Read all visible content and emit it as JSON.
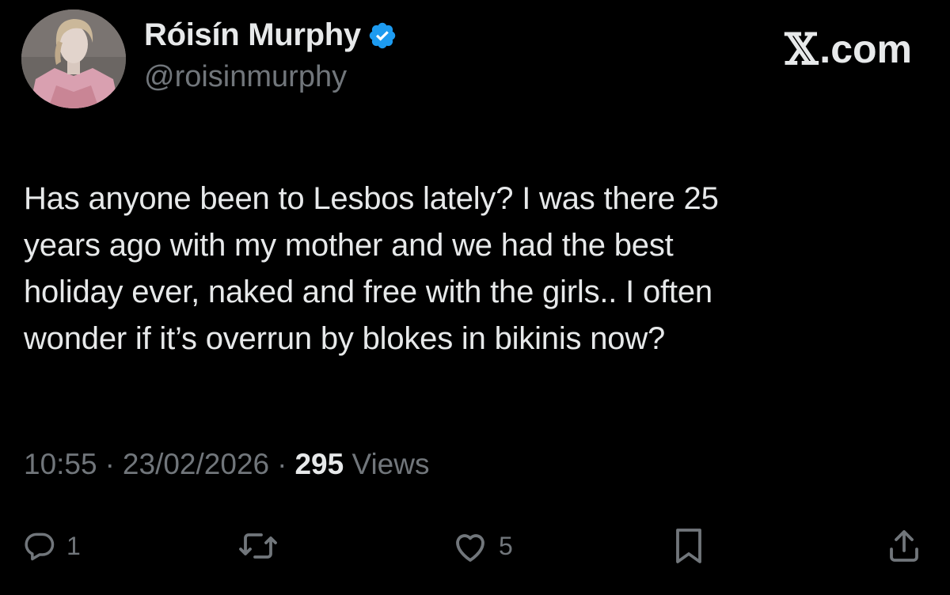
{
  "author": {
    "display_name": "Róisín Murphy",
    "handle": "@roisinmurphy",
    "verified_icon": "verified-badge-icon",
    "avatar": "profile-photo"
  },
  "brand": {
    "domain_text": ".com",
    "logo_icon": "x-logo-icon"
  },
  "tweet": {
    "text_lines": [
      "Has anyone been to Lesbos lately? I was there 25",
      "years ago with my mother and we had the best",
      "holiday ever, naked and free with the girls.. I often",
      "wonder if it’s overrun by blokes in bikinis now?"
    ]
  },
  "meta": {
    "time": "10:55",
    "separator": "·",
    "date": "23/02/2026",
    "views_count": "295",
    "views_label": "Views"
  },
  "actions": {
    "reply": {
      "icon": "reply-icon",
      "count": "1"
    },
    "repost": {
      "icon": "repost-icon",
      "count": ""
    },
    "like": {
      "icon": "heart-icon",
      "count": "5"
    },
    "bookmark": {
      "icon": "bookmark-icon",
      "count": ""
    },
    "share": {
      "icon": "share-icon",
      "count": ""
    }
  },
  "colors": {
    "background": "#000000",
    "text_primary": "#e7e9ea",
    "text_secondary": "#71767b",
    "verified_blue": "#1d9bf0"
  }
}
